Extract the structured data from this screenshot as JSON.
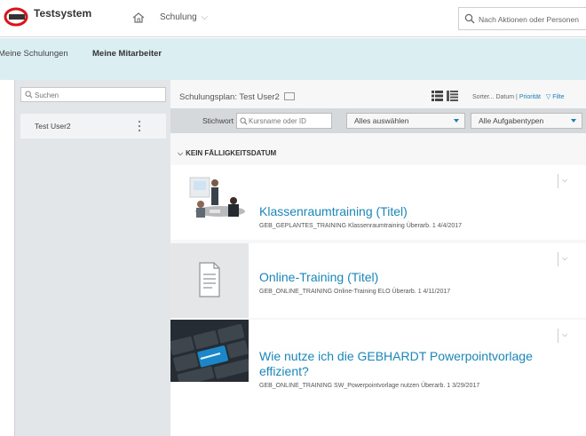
{
  "header": {
    "app_title": "Testsystem",
    "nav_label": "Schulung",
    "search_placeholder": "Nach Aktionen oder Personen"
  },
  "tabs": [
    {
      "label": "Meine Schulungen",
      "active": false
    },
    {
      "label": "Meine Mitarbeiter",
      "active": true
    }
  ],
  "left": {
    "search_placeholder": "Suchen",
    "users": [
      {
        "name": "Test User2"
      }
    ]
  },
  "main": {
    "plan_title": "Schulungsplan: Test User2",
    "sort_label": "Sorter...",
    "sort_date": "Datum",
    "sort_separator": "|",
    "sort_priority": "Priorität",
    "filter_label": "Filte",
    "keyword_label": "Stichwort",
    "keyword_placeholder": "Kursname oder ID",
    "select_all": "Alles auswählen",
    "task_types": "Alle Aufgabentypen",
    "group_heading": "KEIN FÄLLIGKEITSDATUM",
    "items": [
      {
        "title": "Klassenraumtraining (Titel)",
        "meta": "GEB_GEPLANTES_TRAINING Klassenraumtraining Überarb. 1 4/4/2017",
        "image": "classroom-photo"
      },
      {
        "title": "Online-Training (Titel)",
        "meta": "GEB_ONLINE_TRAINING Online-Training ELO Überarb. 1 4/11/2017",
        "image": "document-icon"
      },
      {
        "title": "Wie nutze ich die GEBHARDT Powerpointvorlage effizient?",
        "meta": "GEB_ONLINE_TRAINING SW_Powerpointvorlage nutzen Überarb. 1 3/29/2017",
        "image": "learning-keyboard-photo"
      }
    ]
  },
  "colors": {
    "accent": "#1b86b8",
    "tabbar": "#dbeff2",
    "logo_red": "#d9141b"
  }
}
